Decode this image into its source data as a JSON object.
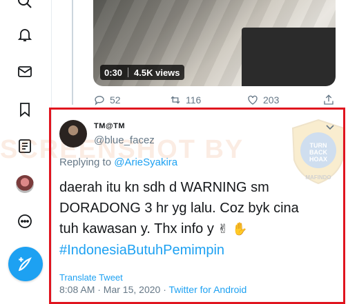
{
  "sidebar": {
    "items": [
      {
        "icon": "search-icon"
      },
      {
        "icon": "bell-icon"
      },
      {
        "icon": "mail-icon"
      },
      {
        "icon": "bookmark-icon"
      },
      {
        "icon": "list-icon"
      },
      {
        "icon": "avatar"
      },
      {
        "icon": "more-icon"
      }
    ],
    "compose_icon": "compose-tweet-icon"
  },
  "media": {
    "duration": "0:30",
    "views": "4.5K views"
  },
  "actions": {
    "replies": "52",
    "retweets": "116",
    "likes": "203"
  },
  "reply_tweet": {
    "display_name": "TM@TM",
    "username": "@blue_facez",
    "replying_prefix": "Replying to",
    "replying_to": "@ArieSyakira",
    "lines": [
      "daerah itu kn sdh d WARNING sm",
      "DORADONG 3 hr yg lalu. Coz byk cina",
      "tuh kawasan y. Thx info y"
    ],
    "emoji": "✌ ✋",
    "hashtag": "#IndonesiaButuhPemimpin",
    "translate_label": "Translate Tweet",
    "timestamp": "8:08 AM · Mar 15, 2020 ·",
    "source_app": "Twitter for Android"
  },
  "watermark": {
    "text": "SCREENSHOT BY",
    "seal_text": "TURN BACK HOAX",
    "seal_ring": "MASYARAKAT ANTI FITNAH INDONESIA",
    "seal_bottom": "MAFINDO"
  },
  "colors": {
    "accent": "#1da1f2",
    "highlight_border": "#e0141e",
    "muted": "#657786"
  }
}
